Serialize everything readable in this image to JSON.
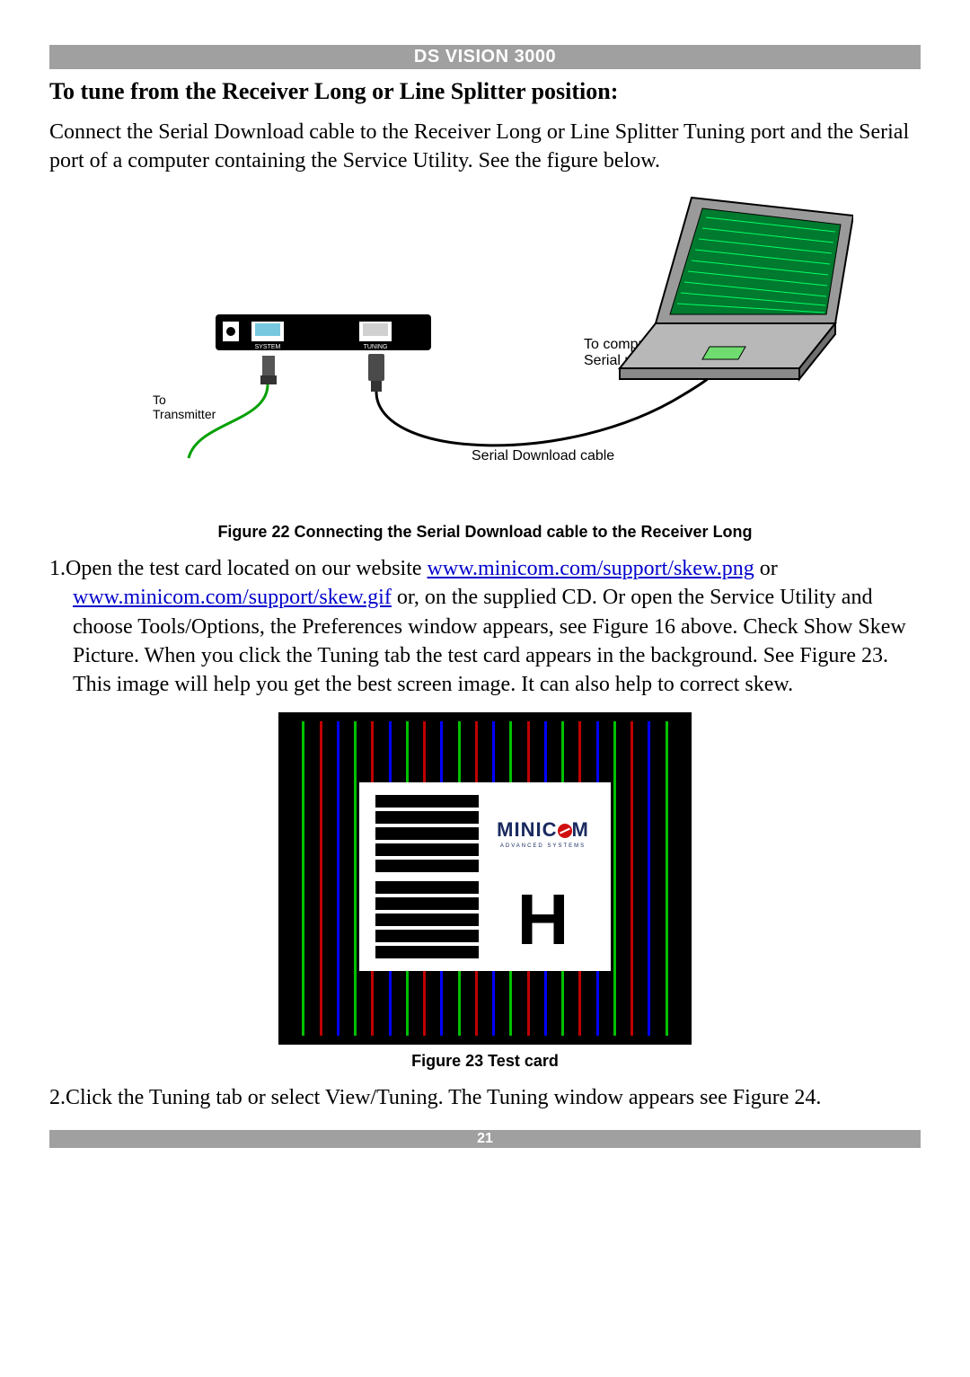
{
  "header": {
    "title": "DS VISION 3000"
  },
  "section": {
    "heading": "To tune from the Receiver Long or Line Splitter position:"
  },
  "para1": "Connect the Serial Download cable to the Receiver Long or Line Splitter Tuning port and the Serial port of a computer containing the Service Utility. See the figure below.",
  "fig22": {
    "label_to_transmitter": "To\nTransmitter",
    "label_tuning": "TUNING",
    "label_system": "SYSTEM",
    "label_serial_cable": "Serial Download cable",
    "label_to_computer": "To computer's\nSerial port",
    "caption": "Figure 22 Connecting the Serial Download cable to the Receiver Long"
  },
  "list": {
    "item1": {
      "marker": "1.",
      "pre": "Open the test card located on our website ",
      "link1": "www.minicom.com/support/skew.png",
      "mid1": " or ",
      "link2": "www.minicom.com/support/skew.gif",
      "post": " or, on the supplied CD. Or open the Service Utility and choose Tools/Options, the Preferences window appears, see Figure 16 above. Check Show Skew Picture. When you click the Tuning tab the test card appears in the background. See Figure 23. This image will help you get the best screen image. It can also help to correct skew."
    },
    "item2": {
      "marker": "2.",
      "text": "Click the Tuning tab or select View/Tuning. The Tuning window appears see Figure 24."
    }
  },
  "fig23": {
    "logo_main": "MINIC",
    "logo_tail": "M",
    "logo_sub": "ADVANCED SYSTEMS",
    "bigH": "H",
    "stripe_colors": [
      "#00c000",
      "#c00000",
      "#0000ff",
      "#00c000",
      "#c00000",
      "#0000ff",
      "#00c000",
      "#c00000",
      "#0000ff",
      "#00c000",
      "#c00000",
      "#0000ff",
      "#00c000",
      "#c00000",
      "#0000ff",
      "#00c000",
      "#c00000",
      "#0000ff",
      "#00c000",
      "#c00000",
      "#0000ff",
      "#00c000"
    ],
    "caption": "Figure 23 Test card"
  },
  "footer": {
    "page": "21"
  }
}
